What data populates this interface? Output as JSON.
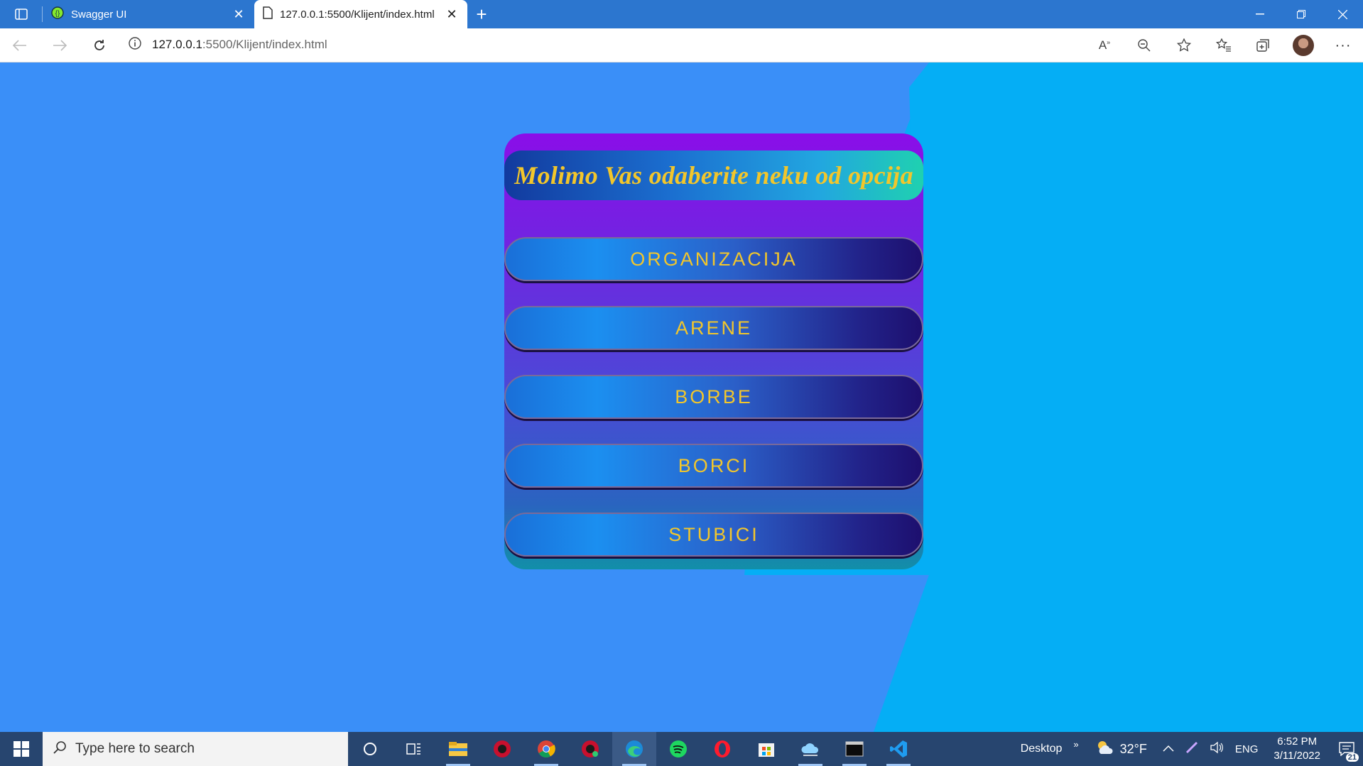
{
  "browser": {
    "tabs": [
      {
        "title": "Swagger UI",
        "active": false,
        "icon": "swagger-icon"
      },
      {
        "title": "127.0.0.1:5500/Klijent/index.html",
        "active": true,
        "icon": "page-icon"
      }
    ],
    "url_host": "127.0.0.1",
    "url_rest": ":5500/Klijent/index.html"
  },
  "page": {
    "heading": "Molimo Vas odaberite neku od opcija",
    "buttons": [
      "ORGANIZACIJA",
      "ARENE",
      "BORBE",
      "BORCI",
      "STUBICI"
    ],
    "colors": {
      "accent_text": "#f2c62b",
      "background": "#3a8ff8",
      "background_right": "#05aef5"
    }
  },
  "taskbar": {
    "search_placeholder": "Type here to search",
    "desktop_label": "Desktop",
    "weather": "32°F",
    "language": "ENG",
    "time": "6:52 PM",
    "date": "3/11/2022",
    "notifications": "21",
    "apps": [
      "cortana-icon",
      "task-view-icon",
      "file-explorer-icon",
      "app-red-icon",
      "chrome-icon",
      "app-red2-icon",
      "edge-icon",
      "spotify-icon",
      "opera-icon",
      "store-icon",
      "app-cloud-icon",
      "terminal-icon",
      "vscode-icon"
    ]
  }
}
